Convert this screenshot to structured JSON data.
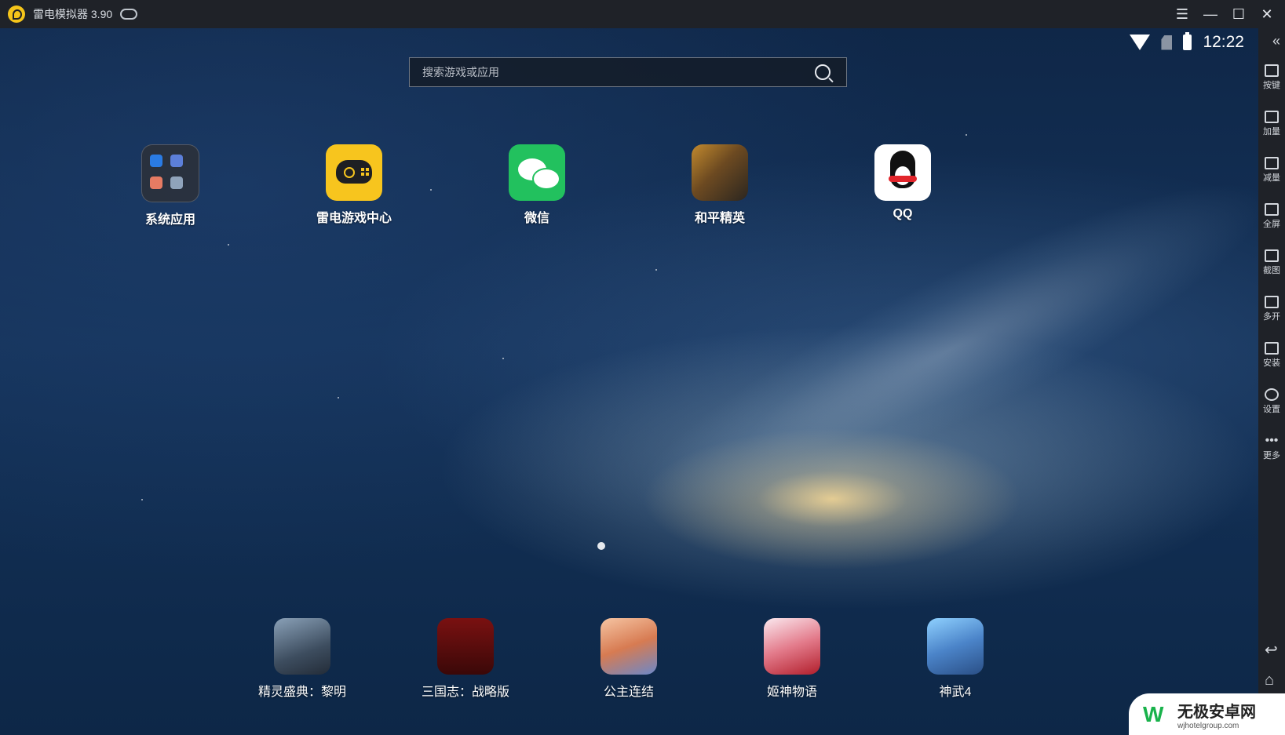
{
  "window": {
    "title": "雷电模拟器 3.90",
    "controls": [
      "menu-icon",
      "minimize-icon",
      "maximize-icon",
      "close-icon"
    ]
  },
  "statusbar": {
    "time": "12:22",
    "icons": [
      "wifi-icon",
      "no-sim-icon",
      "battery-icon"
    ]
  },
  "search": {
    "placeholder": "搜索游戏或应用"
  },
  "home_apps": [
    {
      "label": "系统应用"
    },
    {
      "label": "雷电游戏中心"
    },
    {
      "label": "微信"
    },
    {
      "label": "和平精英"
    },
    {
      "label": "QQ"
    }
  ],
  "dock_apps": [
    {
      "label": "精灵盛典：黎明"
    },
    {
      "label": "三国志：战略版"
    },
    {
      "label": "公主连结"
    },
    {
      "label": "姬神物语"
    },
    {
      "label": "神武4"
    }
  ],
  "sidebar": {
    "items": [
      {
        "label": "按键",
        "icon": "keyboard-icon"
      },
      {
        "label": "加量",
        "icon": "volume-up-icon"
      },
      {
        "label": "减量",
        "icon": "volume-down-icon"
      },
      {
        "label": "全屏",
        "icon": "fullscreen-icon"
      },
      {
        "label": "截图",
        "icon": "scissors-icon"
      },
      {
        "label": "多开",
        "icon": "multi-instance-icon"
      },
      {
        "label": "安装",
        "icon": "apk-install-icon"
      },
      {
        "label": "设置",
        "icon": "gear-icon"
      },
      {
        "label": "更多",
        "icon": "more-icon"
      }
    ]
  },
  "watermark": {
    "title": "无极安卓网",
    "url": "wjhotelgroup.com"
  },
  "colors": {
    "titlebar": "#1f2228",
    "accent": "#f7c51e",
    "wechat": "#22c15e"
  }
}
